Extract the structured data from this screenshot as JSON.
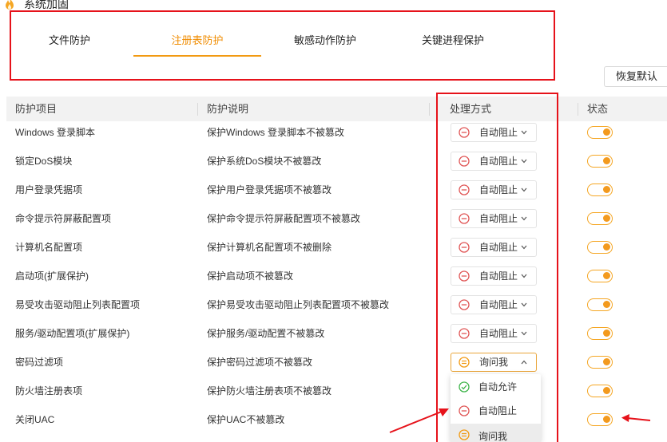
{
  "app": {
    "title": "系统加固"
  },
  "tabs": [
    {
      "label": "文件防护"
    },
    {
      "label": "注册表防护"
    },
    {
      "label": "敏感动作防护"
    },
    {
      "label": "关键进程保护"
    }
  ],
  "restore_button": "恢复默认",
  "table": {
    "headers": {
      "item": "防护项目",
      "desc": "防护说明",
      "action": "处理方式",
      "status": "状态"
    },
    "rows": [
      {
        "name": "Windows 登录脚本",
        "desc": "保护Windows 登录脚本不被篡改",
        "action": "自动阻止"
      },
      {
        "name": "锁定DoS模块",
        "desc": "保护系统DoS模块不被篡改",
        "action": "自动阻止"
      },
      {
        "name": "用户登录凭据项",
        "desc": "保护用户登录凭据项不被篡改",
        "action": "自动阻止"
      },
      {
        "name": "命令提示符屏蔽配置项",
        "desc": "保护命令提示符屏蔽配置项不被篡改",
        "action": "自动阻止"
      },
      {
        "name": "计算机名配置项",
        "desc": "保护计算机名配置项不被删除",
        "action": "自动阻止"
      },
      {
        "name": "启动项(扩展保护)",
        "desc": "保护启动项不被篡改",
        "action": "自动阻止"
      },
      {
        "name": "易受攻击驱动阻止列表配置项",
        "desc": "保护易受攻击驱动阻止列表配置项不被篡改",
        "action": "自动阻止"
      },
      {
        "name": "服务/驱动配置项(扩展保护)",
        "desc": "保护服务/驱动配置不被篡改",
        "action": "自动阻止"
      },
      {
        "name": "密码过滤项",
        "desc": "保护密码过滤项不被篡改",
        "action": "询问我"
      },
      {
        "name": "防火墙注册表项",
        "desc": "保护防火墙注册表项不被篡改",
        "action": ""
      },
      {
        "name": "关闭UAC",
        "desc": "保护UAC不被篡改",
        "action": ""
      }
    ]
  },
  "dropdown": {
    "options": [
      {
        "label": "自动允许",
        "icon": "check-circle-icon"
      },
      {
        "label": "自动阻止",
        "icon": "block-circle-icon"
      },
      {
        "label": "询问我",
        "icon": "ask-circle-icon"
      }
    ],
    "selected": "询问我"
  },
  "colors": {
    "accent": "#f29a12",
    "block": "#e05656",
    "allow": "#3fb54b",
    "annotation": "#e6121a"
  }
}
